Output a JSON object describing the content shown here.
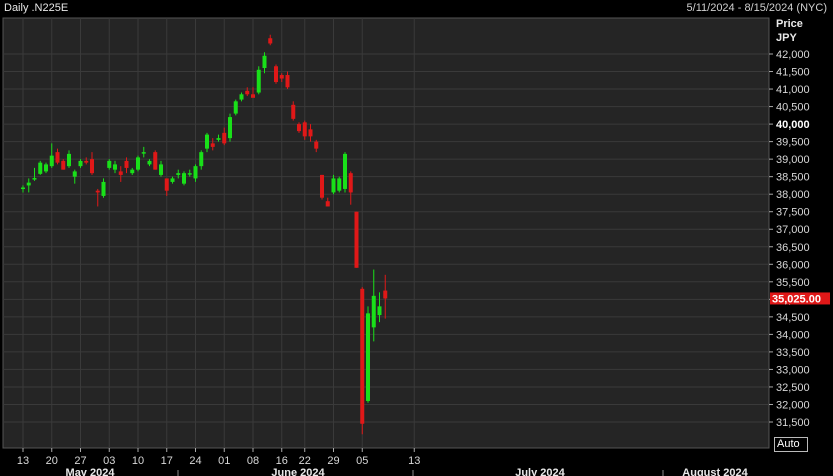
{
  "header": {
    "title": "Daily .N225E",
    "range": "5/11/2024 - 8/15/2024 (NYC)"
  },
  "axis": {
    "price_label": "Price",
    "currency": "JPY",
    "auto_label": "Auto"
  },
  "last_price_label": "35,025.00",
  "colors": {
    "up": "#19e019",
    "down": "#e01818",
    "last_price_bg": "#e01818",
    "plot_bg": "#252525",
    "grid": "#3a3a3a"
  },
  "chart_data": {
    "type": "candlestick",
    "title": "Daily .N225E",
    "ylim": [
      31000,
      42500
    ],
    "yticks": [
      {
        "value": 42000,
        "label": "42,000"
      },
      {
        "value": 41500,
        "label": "41,500"
      },
      {
        "value": 41000,
        "label": "41,000"
      },
      {
        "value": 40500,
        "label": "40,500"
      },
      {
        "value": 40000,
        "label": "40,000",
        "bold": true
      },
      {
        "value": 39500,
        "label": "39,500"
      },
      {
        "value": 39000,
        "label": "39,000"
      },
      {
        "value": 38500,
        "label": "38,500"
      },
      {
        "value": 38000,
        "label": "38,000"
      },
      {
        "value": 37500,
        "label": "37,500"
      },
      {
        "value": 37000,
        "label": "37,000"
      },
      {
        "value": 36500,
        "label": "36,500"
      },
      {
        "value": 36000,
        "label": "36,000"
      },
      {
        "value": 35500,
        "label": "35,500"
      },
      {
        "value": 35000,
        "label": "35,000"
      },
      {
        "value": 34500,
        "label": "34,500"
      },
      {
        "value": 34000,
        "label": "34,000"
      },
      {
        "value": 33500,
        "label": "33,500"
      },
      {
        "value": 33000,
        "label": "33,000"
      },
      {
        "value": 32500,
        "label": "32,500"
      },
      {
        "value": 32000,
        "label": "32,000"
      },
      {
        "value": 31500,
        "label": "31,500"
      }
    ],
    "xticks": [
      "13",
      "20",
      "27",
      "03",
      "10",
      "17",
      "24",
      "01",
      "08",
      "16",
      "22",
      "29",
      "05",
      "13"
    ],
    "months": [
      "May 2024",
      "June 2024",
      "July 2024",
      "August 2024"
    ],
    "last_price": 35025,
    "candles": [
      {
        "d": "2024-05-13",
        "o": 38180,
        "h": 38250,
        "l": 38050,
        "c": 38190
      },
      {
        "d": "2024-05-14",
        "o": 38250,
        "h": 38450,
        "l": 38050,
        "c": 38330
      },
      {
        "d": "2024-05-15",
        "o": 38450,
        "h": 38750,
        "l": 38380,
        "c": 38460
      },
      {
        "d": "2024-05-16",
        "o": 38580,
        "h": 38950,
        "l": 38550,
        "c": 38900
      },
      {
        "d": "2024-05-17",
        "o": 38650,
        "h": 38900,
        "l": 38600,
        "c": 38850
      },
      {
        "d": "2024-05-20",
        "o": 38800,
        "h": 39450,
        "l": 38750,
        "c": 39100
      },
      {
        "d": "2024-05-21",
        "o": 39200,
        "h": 39300,
        "l": 38850,
        "c": 38900
      },
      {
        "d": "2024-05-22",
        "o": 38950,
        "h": 39000,
        "l": 38700,
        "c": 38700
      },
      {
        "d": "2024-05-23",
        "o": 38800,
        "h": 39250,
        "l": 38750,
        "c": 39150
      },
      {
        "d": "2024-05-24",
        "o": 38500,
        "h": 38700,
        "l": 38300,
        "c": 38650
      },
      {
        "d": "2024-05-27",
        "o": 38800,
        "h": 39000,
        "l": 38750,
        "c": 38950
      },
      {
        "d": "2024-05-28",
        "o": 38950,
        "h": 39050,
        "l": 38850,
        "c": 38900
      },
      {
        "d": "2024-05-29",
        "o": 39000,
        "h": 39200,
        "l": 38550,
        "c": 38600
      },
      {
        "d": "2024-05-30",
        "o": 38100,
        "h": 38150,
        "l": 37650,
        "c": 38050
      },
      {
        "d": "2024-05-31",
        "o": 37950,
        "h": 38450,
        "l": 37900,
        "c": 38350
      },
      {
        "d": "2024-06-03",
        "o": 38750,
        "h": 39000,
        "l": 38700,
        "c": 38950
      },
      {
        "d": "2024-06-04",
        "o": 38700,
        "h": 38950,
        "l": 38600,
        "c": 38850
      },
      {
        "d": "2024-06-05",
        "o": 38650,
        "h": 38800,
        "l": 38350,
        "c": 38550
      },
      {
        "d": "2024-06-06",
        "o": 38950,
        "h": 39050,
        "l": 38600,
        "c": 38750
      },
      {
        "d": "2024-06-07",
        "o": 38600,
        "h": 38750,
        "l": 38550,
        "c": 38700
      },
      {
        "d": "2024-06-10",
        "o": 38700,
        "h": 39100,
        "l": 38650,
        "c": 39050
      },
      {
        "d": "2024-06-11",
        "o": 39200,
        "h": 39350,
        "l": 39050,
        "c": 39200
      },
      {
        "d": "2024-06-12",
        "o": 38850,
        "h": 39000,
        "l": 38800,
        "c": 38950
      },
      {
        "d": "2024-06-13",
        "o": 39200,
        "h": 39250,
        "l": 38700,
        "c": 38700
      },
      {
        "d": "2024-06-14",
        "o": 38550,
        "h": 38950,
        "l": 38500,
        "c": 38850
      },
      {
        "d": "2024-06-17",
        "o": 38450,
        "h": 38450,
        "l": 37950,
        "c": 38100
      },
      {
        "d": "2024-06-18",
        "o": 38350,
        "h": 38500,
        "l": 38300,
        "c": 38450
      },
      {
        "d": "2024-06-19",
        "o": 38550,
        "h": 38700,
        "l": 38450,
        "c": 38600
      },
      {
        "d": "2024-06-20",
        "o": 38300,
        "h": 38650,
        "l": 38250,
        "c": 38600
      },
      {
        "d": "2024-06-21",
        "o": 38600,
        "h": 38700,
        "l": 38500,
        "c": 38600
      },
      {
        "d": "2024-06-24",
        "o": 38450,
        "h": 38850,
        "l": 38350,
        "c": 38800
      },
      {
        "d": "2024-06-25",
        "o": 38800,
        "h": 39250,
        "l": 38700,
        "c": 39200
      },
      {
        "d": "2024-06-26",
        "o": 39300,
        "h": 39750,
        "l": 39200,
        "c": 39700
      },
      {
        "d": "2024-06-27",
        "o": 39450,
        "h": 39600,
        "l": 39250,
        "c": 39350
      },
      {
        "d": "2024-06-28",
        "o": 39550,
        "h": 39700,
        "l": 39500,
        "c": 39600
      },
      {
        "d": "2024-07-01",
        "o": 39750,
        "h": 39900,
        "l": 39400,
        "c": 39450
      },
      {
        "d": "2024-07-02",
        "o": 39600,
        "h": 40300,
        "l": 39500,
        "c": 40200
      },
      {
        "d": "2024-07-03",
        "o": 40300,
        "h": 40700,
        "l": 40250,
        "c": 40650
      },
      {
        "d": "2024-07-04",
        "o": 40700,
        "h": 40900,
        "l": 40650,
        "c": 40850
      },
      {
        "d": "2024-07-05",
        "o": 40950,
        "h": 41050,
        "l": 40800,
        "c": 40850
      },
      {
        "d": "2024-07-08",
        "o": 40850,
        "h": 41050,
        "l": 40800,
        "c": 40750
      },
      {
        "d": "2024-07-09",
        "o": 40900,
        "h": 41650,
        "l": 40850,
        "c": 41550
      },
      {
        "d": "2024-07-10",
        "o": 41600,
        "h": 42050,
        "l": 41450,
        "c": 41950
      },
      {
        "d": "2024-07-11",
        "o": 42450,
        "h": 42550,
        "l": 42250,
        "c": 42300
      },
      {
        "d": "2024-07-12",
        "o": 41650,
        "h": 41700,
        "l": 41150,
        "c": 41200
      },
      {
        "d": "2024-07-16",
        "o": 41400,
        "h": 41450,
        "l": 41200,
        "c": 41300
      },
      {
        "d": "2024-07-17",
        "o": 41400,
        "h": 41500,
        "l": 41000,
        "c": 41050
      },
      {
        "d": "2024-07-18",
        "o": 40550,
        "h": 40650,
        "l": 40100,
        "c": 40150
      },
      {
        "d": "2024-07-19",
        "o": 40000,
        "h": 40050,
        "l": 39750,
        "c": 39800
      },
      {
        "d": "2024-07-22",
        "o": 40050,
        "h": 40100,
        "l": 39550,
        "c": 39650
      },
      {
        "d": "2024-07-23",
        "o": 39850,
        "h": 40000,
        "l": 39500,
        "c": 39650
      },
      {
        "d": "2024-07-24",
        "o": 39500,
        "h": 39550,
        "l": 39200,
        "c": 39300
      },
      {
        "d": "2024-07-25",
        "o": 38550,
        "h": 38550,
        "l": 37850,
        "c": 37900
      },
      {
        "d": "2024-07-26",
        "o": 37800,
        "h": 37900,
        "l": 37650,
        "c": 37650
      },
      {
        "d": "2024-07-29",
        "o": 38050,
        "h": 38550,
        "l": 38000,
        "c": 38450
      },
      {
        "d": "2024-07-30",
        "o": 38100,
        "h": 38500,
        "l": 38050,
        "c": 38450
      },
      {
        "d": "2024-07-31",
        "o": 38150,
        "h": 39200,
        "l": 38050,
        "c": 39150
      },
      {
        "d": "2024-08-01",
        "o": 38600,
        "h": 38650,
        "l": 37700,
        "c": 38050
      },
      {
        "d": "2024-08-02",
        "o": 37500,
        "h": 37500,
        "l": 35900,
        "c": 35900
      },
      {
        "d": "2024-08-05",
        "o": 35300,
        "h": 35350,
        "l": 31150,
        "c": 31450
      },
      {
        "d": "2024-08-06",
        "o": 32100,
        "h": 34800,
        "l": 32050,
        "c": 34600
      },
      {
        "d": "2024-08-07",
        "o": 34200,
        "h": 35850,
        "l": 33800,
        "c": 35100
      },
      {
        "d": "2024-08-08",
        "o": 34550,
        "h": 35200,
        "l": 34350,
        "c": 34800
      },
      {
        "d": "2024-08-09",
        "o": 35250,
        "h": 35700,
        "l": 34450,
        "c": 35025
      }
    ]
  }
}
